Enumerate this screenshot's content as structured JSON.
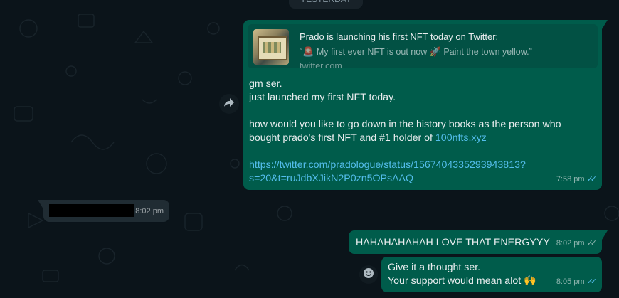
{
  "date_chip": "YESTERDAY",
  "messages": [
    {
      "preview": {
        "title": "Prado is launching his first NFT today on Twitter:",
        "description_prefix": "“",
        "description_part1": "My first ever NFT is out now",
        "description_part2": "Paint the town yellow.”",
        "host": "twitter.com",
        "emoji_1": "🚨",
        "emoji_2": "🚀"
      },
      "line1": "gm ser.",
      "line2": "just launched my first NFT today.",
      "line3": "how would you like to go down in the history books as the person who",
      "line4": "bought prado's first NFT and #1 holder of ",
      "line4_link": "100nfts.xyz",
      "url_line1": "https://twitter.com/pradologue/status/1567404335293943813?",
      "url_line2": "s=20&t=ruJdbXJikN2P0zn5OPsAAQ",
      "time": "7:58 pm",
      "ticks": "✓✓"
    },
    {
      "time": "8:02 pm"
    },
    {
      "text": "HAHAHAHAHAH LOVE THAT ENERGYYY",
      "time": "8:02 pm",
      "ticks": "✓✓"
    },
    {
      "line1": "Give it a thought ser.",
      "line2": "Your support would mean alot",
      "emoji": "🙌",
      "time": "8:05 pm",
      "ticks": "✓✓"
    }
  ],
  "colors": {
    "outgoing": "#005c4b",
    "incoming": "#202c33",
    "link": "#53bdeb",
    "background": "#0b141a"
  },
  "icons": [
    "forward-icon",
    "emoji-smiley-icon",
    "double-check-icon"
  ]
}
